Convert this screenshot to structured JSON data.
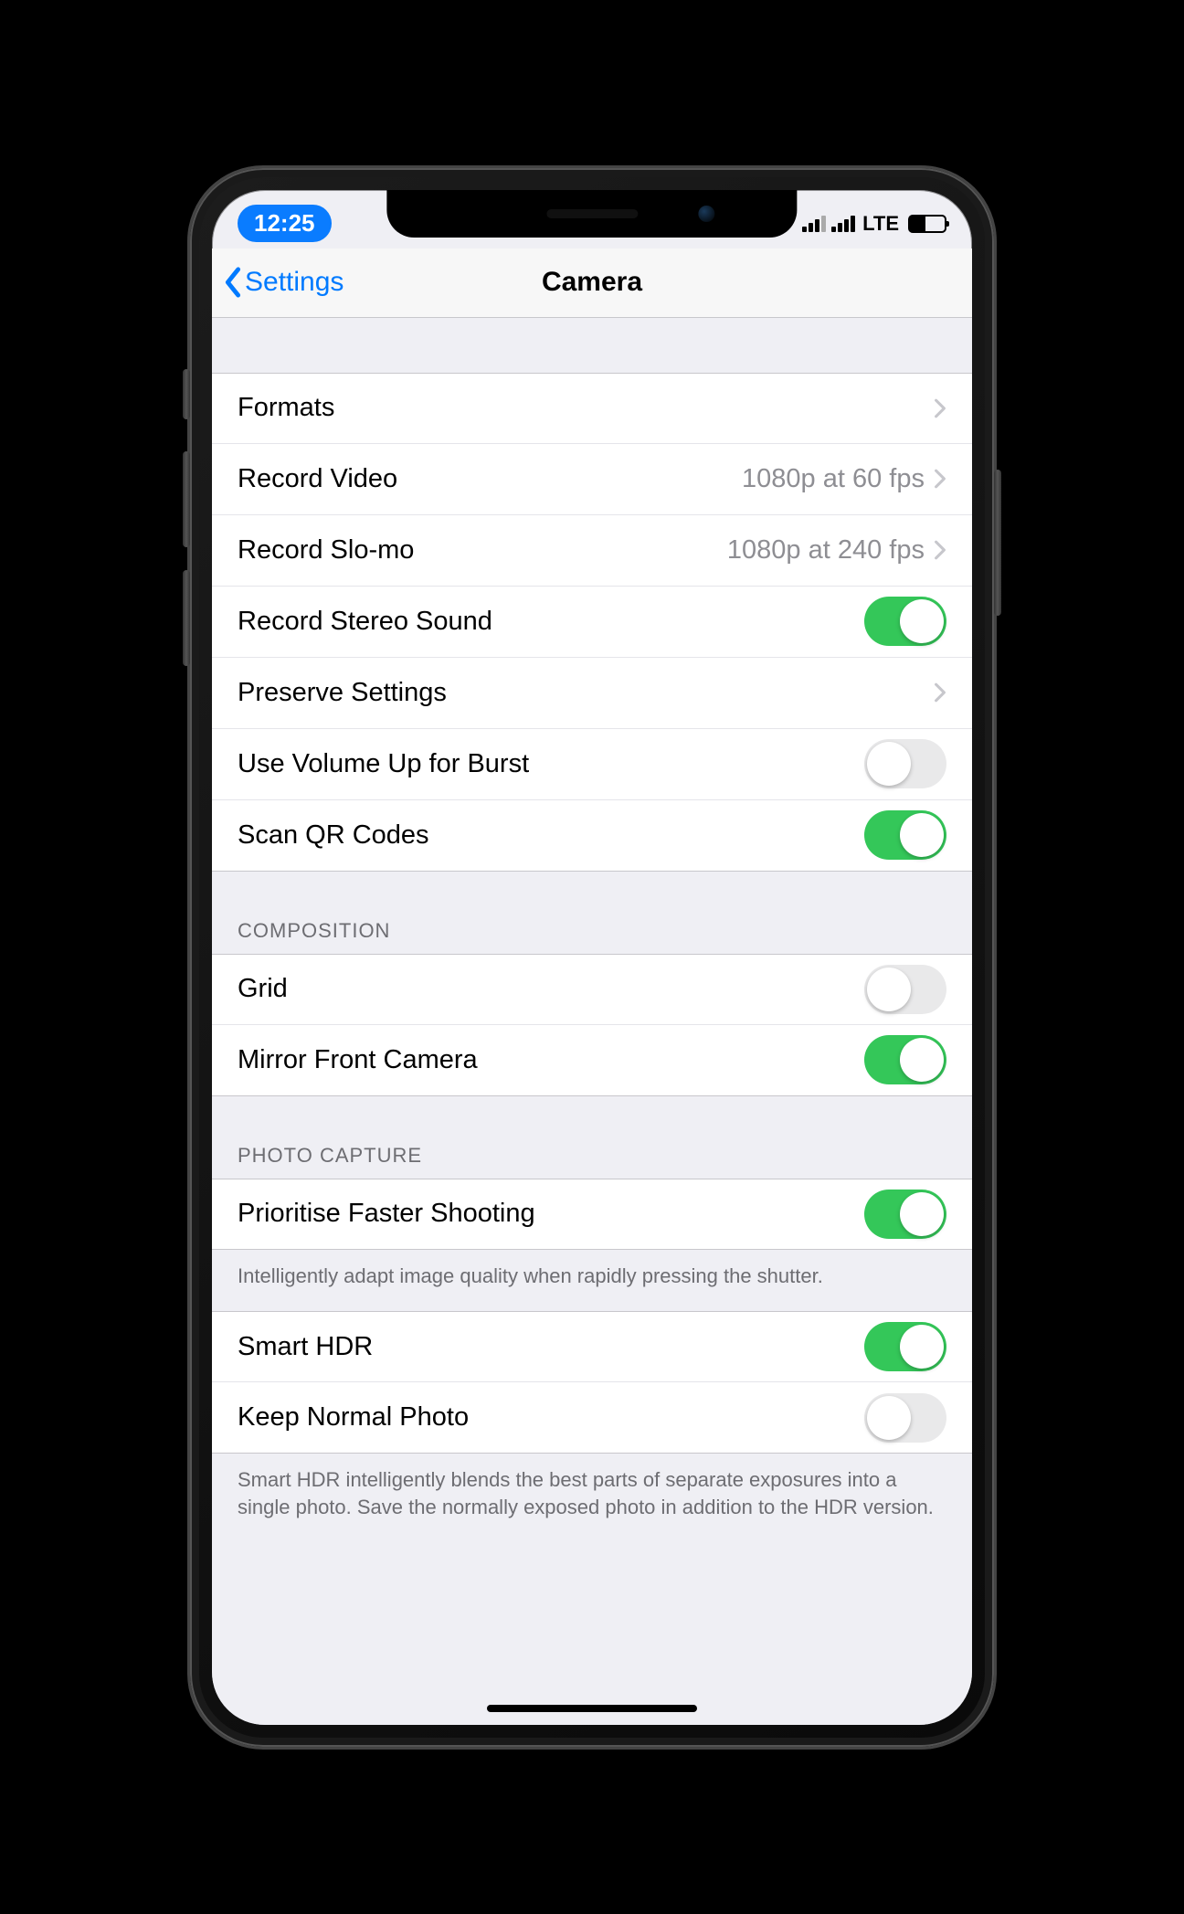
{
  "status": {
    "time": "12:25",
    "network": "LTE"
  },
  "nav": {
    "back": "Settings",
    "title": "Camera"
  },
  "section1": {
    "formats": {
      "label": "Formats"
    },
    "recordVideo": {
      "label": "Record Video",
      "value": "1080p at 60 fps"
    },
    "recordSlomo": {
      "label": "Record Slo-mo",
      "value": "1080p at 240 fps"
    },
    "stereoSound": {
      "label": "Record Stereo Sound",
      "on": true
    },
    "preserve": {
      "label": "Preserve Settings"
    },
    "volumeBurst": {
      "label": "Use Volume Up for Burst",
      "on": false
    },
    "scanQR": {
      "label": "Scan QR Codes",
      "on": true
    }
  },
  "section2": {
    "header": "COMPOSITION",
    "grid": {
      "label": "Grid",
      "on": false
    },
    "mirror": {
      "label": "Mirror Front Camera",
      "on": true
    }
  },
  "section3": {
    "header": "PHOTO CAPTURE",
    "faster": {
      "label": "Prioritise Faster Shooting",
      "on": true
    },
    "fasterFooter": "Intelligently adapt image quality when rapidly pressing the shutter.",
    "smartHDR": {
      "label": "Smart HDR",
      "on": true
    },
    "keepNormal": {
      "label": "Keep Normal Photo",
      "on": false
    },
    "hdrFooter": "Smart HDR intelligently blends the best parts of separate exposures into a single photo. Save the normally exposed photo in addition to the HDR version."
  },
  "colors": {
    "toggleOn": "#34c759",
    "link": "#007aff",
    "groupedBg": "#efeff4"
  }
}
